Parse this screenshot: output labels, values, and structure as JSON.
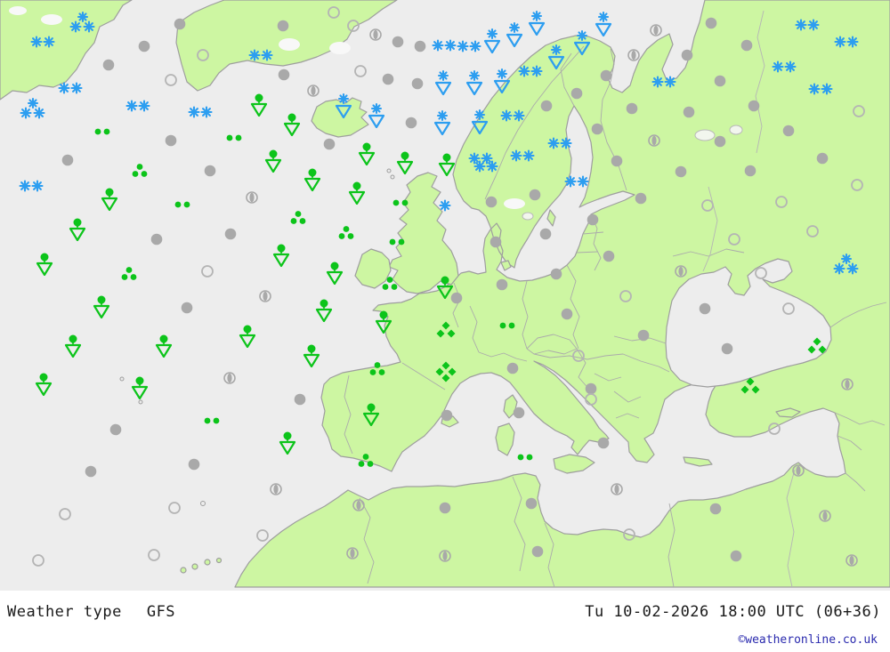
{
  "caption_bar": {
    "product_label": "Weather type",
    "model_label": "GFS",
    "datetime_label": "Tu 10-02-2026 18:00 UTC (06+36)",
    "copyright_label": "©weatheronline.co.uk"
  },
  "colors": {
    "land": "#cdf6a2",
    "sea": "#ededed",
    "coast": "#9e9e9e",
    "border": "#ababab",
    "snow": "#2d9ef0",
    "rain": "#0cc41a",
    "cloud_fill": "#a9a9a9",
    "cloud_outline": "#b4b4b4",
    "text": "#1a1a1a",
    "copyright": "#2a2aae",
    "bar_bg": "#ffffff"
  },
  "symbol_types": {
    "snow2": "snow (two snowflakes)",
    "snow3": "heavy snow (three snowflakes)",
    "snow1": "light snow (single snowflake)",
    "snowshower": "snow shower (snowflake over triangle)",
    "rainshower": "rain shower (drop over triangle)",
    "rain2": "drizzle / light rain (two dots)",
    "rain3": "rain (three dots)",
    "sleet3": "sleet / graupel (three diamonds)",
    "sleet4": "heavy sleet (four diamonds)",
    "cloud": "cloudy (filled circle)",
    "clear": "clear (open circle)",
    "partly": "partly cloudy (half-filled circle)"
  },
  "symbols": [
    [
      "snow3",
      92,
      26
    ],
    [
      "snow2",
      48,
      47
    ],
    [
      "snow2",
      79,
      99
    ],
    [
      "snow3",
      36,
      123
    ],
    [
      "snow2",
      155,
      119
    ],
    [
      "snow2",
      225,
      126
    ],
    [
      "snow2",
      293,
      62
    ],
    [
      "snow2",
      35,
      209
    ],
    [
      "snow2",
      499,
      51
    ],
    [
      "snow2",
      527,
      52
    ],
    [
      "snow2",
      596,
      80
    ],
    [
      "snow2",
      576,
      130
    ],
    [
      "snow2",
      629,
      161
    ],
    [
      "snow2",
      587,
      175
    ],
    [
      "snow2",
      540,
      178
    ],
    [
      "snow2",
      546,
      187
    ],
    [
      "snow2",
      648,
      204
    ],
    [
      "snow2",
      746,
      92
    ],
    [
      "snow2",
      907,
      28
    ],
    [
      "snow2",
      951,
      47
    ],
    [
      "snow2",
      881,
      75
    ],
    [
      "snow2",
      922,
      100
    ],
    [
      "snow3",
      950,
      298
    ],
    [
      "snow1",
      500,
      231
    ],
    [
      "snowshower",
      603,
      27
    ],
    [
      "snowshower",
      678,
      28
    ],
    [
      "snowshower",
      578,
      40
    ],
    [
      "snowshower",
      553,
      47
    ],
    [
      "snowshower",
      654,
      49
    ],
    [
      "snowshower",
      625,
      65
    ],
    [
      "snowshower",
      533,
      94
    ],
    [
      "snowshower",
      564,
      92
    ],
    [
      "snowshower",
      498,
      94
    ],
    [
      "snowshower",
      539,
      138
    ],
    [
      "snowshower",
      497,
      139
    ],
    [
      "snowshower",
      386,
      120
    ],
    [
      "snowshower",
      423,
      131
    ],
    [
      "rainshower",
      291,
      118
    ],
    [
      "rainshower",
      328,
      140
    ],
    [
      "rainshower",
      412,
      173
    ],
    [
      "rainshower",
      307,
      181
    ],
    [
      "rainshower",
      351,
      202
    ],
    [
      "rainshower",
      455,
      183
    ],
    [
      "rainshower",
      401,
      217
    ],
    [
      "rainshower",
      316,
      287
    ],
    [
      "rainshower",
      376,
      307
    ],
    [
      "rainshower",
      364,
      349
    ],
    [
      "rainshower",
      123,
      224
    ],
    [
      "rainshower",
      87,
      258
    ],
    [
      "rainshower",
      50,
      297
    ],
    [
      "rainshower",
      114,
      345
    ],
    [
      "rainshower",
      82,
      389
    ],
    [
      "rainshower",
      184,
      389
    ],
    [
      "rainshower",
      49,
      432
    ],
    [
      "rainshower",
      157,
      436
    ],
    [
      "rainshower",
      278,
      378
    ],
    [
      "rainshower",
      350,
      400
    ],
    [
      "rainshower",
      431,
      362
    ],
    [
      "rainshower",
      417,
      466
    ],
    [
      "rainshower",
      323,
      498
    ],
    [
      "rainshower",
      500,
      323
    ],
    [
      "rainshower",
      502,
      185
    ],
    [
      "rain2",
      115,
      148
    ],
    [
      "rain2",
      263,
      155
    ],
    [
      "rain2",
      205,
      230
    ],
    [
      "rain2",
      450,
      228
    ],
    [
      "rain2",
      446,
      272
    ],
    [
      "rain2",
      238,
      473
    ],
    [
      "rain2",
      570,
      366
    ],
    [
      "rain2",
      590,
      514
    ],
    [
      "rain3",
      157,
      192
    ],
    [
      "rain3",
      145,
      308
    ],
    [
      "rain3",
      335,
      245
    ],
    [
      "rain3",
      389,
      262
    ],
    [
      "rain3",
      438,
      319
    ],
    [
      "rain3",
      424,
      415
    ],
    [
      "rain3",
      411,
      518
    ],
    [
      "sleet3",
      843,
      435
    ],
    [
      "sleet3",
      918,
      390
    ],
    [
      "sleet3",
      501,
      372
    ],
    [
      "sleet4",
      501,
      418
    ],
    [
      "cloud",
      202,
      27
    ],
    [
      "cloud",
      162,
      52
    ],
    [
      "cloud",
      122,
      73
    ],
    [
      "cloud",
      318,
      29
    ],
    [
      "cloud",
      447,
      47
    ],
    [
      "cloud",
      472,
      52
    ],
    [
      "cloud",
      319,
      84
    ],
    [
      "cloud",
      436,
      89
    ],
    [
      "cloud",
      469,
      94
    ],
    [
      "cloud",
      370,
      162
    ],
    [
      "cloud",
      462,
      138
    ],
    [
      "cloud",
      681,
      85
    ],
    [
      "cloud",
      648,
      105
    ],
    [
      "cloud",
      614,
      119
    ],
    [
      "cloud",
      671,
      145
    ],
    [
      "cloud",
      710,
      122
    ],
    [
      "cloud",
      799,
      26
    ],
    [
      "cloud",
      839,
      51
    ],
    [
      "cloud",
      772,
      62
    ],
    [
      "cloud",
      809,
      91
    ],
    [
      "cloud",
      847,
      119
    ],
    [
      "cloud",
      774,
      126
    ],
    [
      "cloud",
      809,
      159
    ],
    [
      "cloud",
      886,
      147
    ],
    [
      "cloud",
      924,
      178
    ],
    [
      "cloud",
      236,
      192
    ],
    [
      "cloud",
      176,
      269
    ],
    [
      "cloud",
      210,
      346
    ],
    [
      "cloud",
      259,
      263
    ],
    [
      "cloud",
      693,
      181
    ],
    [
      "cloud",
      601,
      219
    ],
    [
      "cloud",
      552,
      227
    ],
    [
      "cloud",
      720,
      223
    ],
    [
      "cloud",
      666,
      247
    ],
    [
      "cloud",
      613,
      263
    ],
    [
      "cloud",
      557,
      272
    ],
    [
      "cloud",
      684,
      288
    ],
    [
      "cloud",
      625,
      308
    ],
    [
      "cloud",
      564,
      320
    ],
    [
      "cloud",
      637,
      353
    ],
    [
      "cloud",
      513,
      335
    ],
    [
      "cloud",
      765,
      193
    ],
    [
      "cloud",
      843,
      192
    ],
    [
      "cloud",
      792,
      347
    ],
    [
      "cloud",
      130,
      483
    ],
    [
      "cloud",
      102,
      530
    ],
    [
      "cloud",
      218,
      522
    ],
    [
      "cloud",
      337,
      449
    ],
    [
      "cloud",
      723,
      377
    ],
    [
      "cloud",
      576,
      414
    ],
    [
      "cloud",
      583,
      464
    ],
    [
      "cloud",
      678,
      498
    ],
    [
      "cloud",
      502,
      467
    ],
    [
      "cloud",
      817,
      392
    ],
    [
      "cloud",
      597,
      566
    ],
    [
      "cloud",
      604,
      620
    ],
    [
      "cloud",
      804,
      572
    ],
    [
      "cloud",
      827,
      625
    ],
    [
      "cloud",
      192,
      158
    ],
    [
      "cloud",
      76,
      180
    ],
    [
      "cloud",
      664,
      437
    ],
    [
      "cloud",
      500,
      571
    ],
    [
      "clear",
      192,
      90
    ],
    [
      "clear",
      228,
      62
    ],
    [
      "clear",
      375,
      14
    ],
    [
      "clear",
      397,
      29
    ],
    [
      "clear",
      405,
      80
    ],
    [
      "clear",
      233,
      305
    ],
    [
      "clear",
      963,
      208
    ],
    [
      "clear",
      795,
      231
    ],
    [
      "clear",
      878,
      227
    ],
    [
      "clear",
      913,
      260
    ],
    [
      "clear",
      825,
      269
    ],
    [
      "clear",
      855,
      307
    ],
    [
      "clear",
      886,
      347
    ],
    [
      "clear",
      965,
      125
    ],
    [
      "clear",
      703,
      333
    ],
    [
      "clear",
      650,
      400
    ],
    [
      "clear",
      664,
      449
    ],
    [
      "clear",
      73,
      578
    ],
    [
      "clear",
      196,
      571
    ],
    [
      "clear",
      43,
      630
    ],
    [
      "clear",
      173,
      624
    ],
    [
      "clear",
      295,
      602
    ],
    [
      "clear",
      870,
      482
    ],
    [
      "clear",
      707,
      601
    ],
    [
      "partly",
      422,
      39
    ],
    [
      "partly",
      352,
      102
    ],
    [
      "partly",
      737,
      34
    ],
    [
      "partly",
      712,
      62
    ],
    [
      "partly",
      735,
      158
    ],
    [
      "partly",
      283,
      222
    ],
    [
      "partly",
      298,
      333
    ],
    [
      "partly",
      258,
      425
    ],
    [
      "partly",
      765,
      305
    ],
    [
      "partly",
      952,
      432
    ],
    [
      "partly",
      310,
      550
    ],
    [
      "partly",
      403,
      568
    ],
    [
      "partly",
      396,
      622
    ],
    [
      "partly",
      500,
      625
    ],
    [
      "partly",
      693,
      550
    ],
    [
      "partly",
      927,
      580
    ],
    [
      "partly",
      957,
      630
    ],
    [
      "partly",
      897,
      529
    ]
  ]
}
